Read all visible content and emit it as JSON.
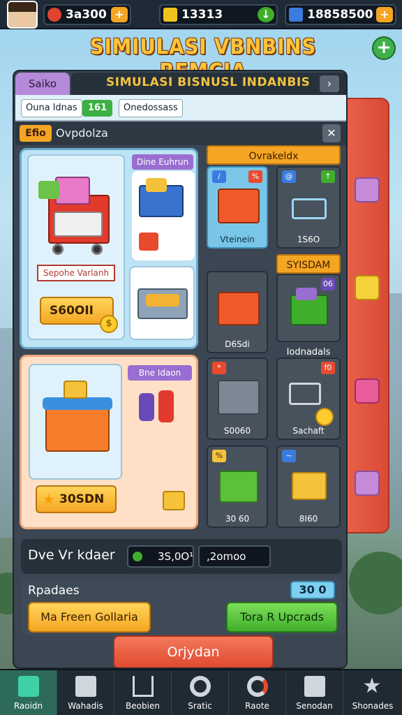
{
  "top_bar": {
    "resource_1": "3a300  1",
    "resource_2": "13313",
    "resource_3": "18858500",
    "buttons": [
      "+",
      "↓",
      "+"
    ]
  },
  "title": "SIMIULASI VBNBINS REMCIA",
  "window": {
    "tab_left": "Saiko",
    "tab_main": "SIMULASI BISNUSL INDANBIS",
    "tab_arrow": "›",
    "chip_1": "Ouna ldnas",
    "chip_green": "161",
    "chip_2": "Onedossass",
    "header_badge": "Efio",
    "header_title": "Ovpdolza",
    "close": "✕"
  },
  "card_1": {
    "tag": "Dine Euhrun",
    "label": "Sepohe Varlanh",
    "price": "S60OII",
    "coin": "$"
  },
  "card_2": {
    "tag": "Bne Idaon",
    "price": "30SDN",
    "star": "★"
  },
  "tiles_header_1": "Ovrakeldx",
  "tiles_header_2": "SYISDAM",
  "tiles_header_3": "Iodnadals",
  "tiles": [
    {
      "label": "Vteinein",
      "badge_l": "/",
      "badge_r": "%"
    },
    {
      "label": "1S6O",
      "badge_l": "@",
      "badge_r": "↑"
    },
    {
      "label": "D6Sdi",
      "badge_l": "",
      "badge_r": ""
    },
    {
      "label": "",
      "badge_l": "",
      "badge_r": "06"
    },
    {
      "label": "S0060",
      "badge_l": "*",
      "badge_r": ""
    },
    {
      "label": "Sachaft",
      "badge_l": "",
      "badge_r": "f0"
    },
    {
      "label": "30 60",
      "badge_l": "%",
      "badge_r": ""
    },
    {
      "label": "8I60",
      "badge_l": "~",
      "badge_r": ""
    }
  ],
  "bottom": {
    "row1_label": "Dve Vr kdaer",
    "input_1": "3S,0O¹",
    "input_2": ",2omoo",
    "row2_label": "Rpadaes",
    "count": "30 0",
    "btn_orange": "Ma Freen Gollaria",
    "btn_green": "Tora R Upcrads",
    "btn_red": "Orjydan"
  },
  "nav": [
    {
      "label": "Raoidn",
      "icon": "store-icon"
    },
    {
      "label": "Wahadis",
      "icon": "fridge-icon"
    },
    {
      "label": "Beobien",
      "icon": "cart-icon"
    },
    {
      "label": "Sratic",
      "icon": "gear-icon"
    },
    {
      "label": "Raote",
      "icon": "wrench-icon"
    },
    {
      "label": "Senodan",
      "icon": "crate-icon"
    },
    {
      "label": "Shonades",
      "icon": "star-icon"
    }
  ],
  "colors": {
    "accent_orange": "#f5a524",
    "accent_green": "#3fae2c",
    "accent_red": "#e04a30",
    "panel_dark": "#3b4652"
  }
}
